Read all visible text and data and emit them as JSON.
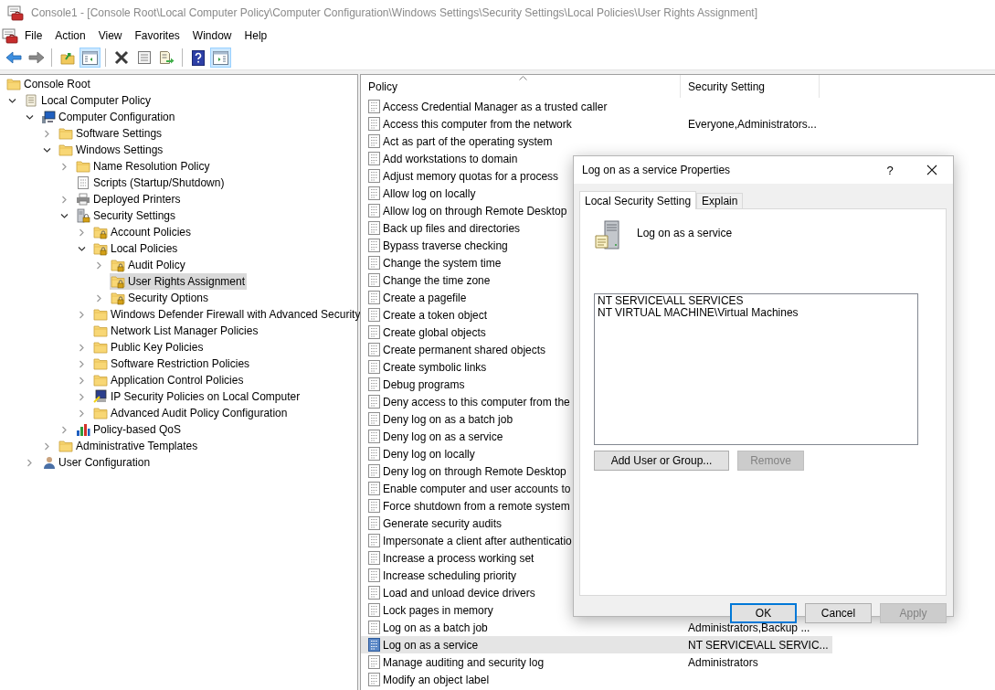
{
  "window": {
    "title": "Console1 - [Console Root\\Local Computer Policy\\Computer Configuration\\Windows Settings\\Security Settings\\Local Policies\\User Rights Assignment]"
  },
  "menu": [
    "File",
    "Action",
    "View",
    "Favorites",
    "Window",
    "Help"
  ],
  "toolbar": [
    {
      "kind": "back",
      "pressed": false
    },
    {
      "kind": "forward",
      "pressed": false
    },
    {
      "kind": "separator"
    },
    {
      "kind": "up",
      "pressed": false
    },
    {
      "kind": "tree-pane",
      "pressed": true
    },
    {
      "kind": "separator"
    },
    {
      "kind": "delete",
      "pressed": false
    },
    {
      "kind": "properties",
      "pressed": false
    },
    {
      "kind": "export",
      "pressed": false
    },
    {
      "kind": "separator"
    },
    {
      "kind": "help",
      "pressed": false
    },
    {
      "kind": "action-pane",
      "pressed": true
    }
  ],
  "tree": [
    {
      "label": "Console Root",
      "kind": "folder",
      "selected": false,
      "children": [
        {
          "label": "Local Computer Policy",
          "kind": "policy",
          "expanded": true,
          "selected": false,
          "children": [
            {
              "label": "Computer Configuration",
              "kind": "computer",
              "expanded": true,
              "selected": false,
              "children": [
                {
                  "label": "Software Settings",
                  "kind": "folder",
                  "expanded": false,
                  "selected": false
                },
                {
                  "label": "Windows Settings",
                  "kind": "folder",
                  "expanded": true,
                  "selected": false,
                  "children": [
                    {
                      "label": "Name Resolution Policy",
                      "kind": "folder",
                      "expanded": false,
                      "selected": false
                    },
                    {
                      "label": "Scripts (Startup/Shutdown)",
                      "kind": "scripts",
                      "selected": false
                    },
                    {
                      "label": "Deployed Printers",
                      "kind": "printer",
                      "expanded": false,
                      "selected": false
                    },
                    {
                      "label": "Security Settings",
                      "kind": "security",
                      "expanded": true,
                      "selected": false,
                      "children": [
                        {
                          "label": "Account Policies",
                          "kind": "locked-folder",
                          "expanded": false,
                          "selected": false
                        },
                        {
                          "label": "Local Policies",
                          "kind": "locked-folder",
                          "expanded": true,
                          "selected": false,
                          "children": [
                            {
                              "label": "Audit Policy",
                              "kind": "locked-folder",
                              "expanded": false,
                              "selected": false
                            },
                            {
                              "label": "User Rights Assignment",
                              "kind": "locked-folder",
                              "selected": true
                            },
                            {
                              "label": "Security Options",
                              "kind": "locked-folder",
                              "expanded": false,
                              "selected": false
                            }
                          ]
                        },
                        {
                          "label": "Windows Defender Firewall with Advanced Security",
                          "kind": "folder",
                          "expanded": false,
                          "selected": false
                        },
                        {
                          "label": "Network List Manager Policies",
                          "kind": "folder",
                          "selected": false
                        },
                        {
                          "label": "Public Key Policies",
                          "kind": "folder",
                          "expanded": false,
                          "selected": false
                        },
                        {
                          "label": "Software Restriction Policies",
                          "kind": "folder",
                          "expanded": false,
                          "selected": false
                        },
                        {
                          "label": "Application Control Policies",
                          "kind": "folder",
                          "expanded": false,
                          "selected": false
                        },
                        {
                          "label": "IP Security Policies on Local Computer",
                          "kind": "ip-security",
                          "expanded": false,
                          "selected": false
                        },
                        {
                          "label": "Advanced Audit Policy Configuration",
                          "kind": "folder",
                          "expanded": false,
                          "selected": false
                        }
                      ]
                    },
                    {
                      "label": "Policy-based QoS",
                      "kind": "qos",
                      "expanded": false,
                      "selected": false
                    }
                  ]
                },
                {
                  "label": "Administrative Templates",
                  "kind": "folder",
                  "expanded": false,
                  "selected": false
                }
              ]
            },
            {
              "label": "User Configuration",
              "kind": "user",
              "expanded": false,
              "selected": false
            }
          ]
        }
      ]
    }
  ],
  "table": {
    "columns": [
      "Policy",
      "Security Setting"
    ],
    "rows": [
      {
        "policy": "Access Credential Manager as a trusted caller",
        "selected": false
      },
      {
        "policy": "Access this computer from the network",
        "setting": "Everyone,Administrators...",
        "selected": false
      },
      {
        "policy": "Act as part of the operating system",
        "selected": false
      },
      {
        "policy": "Add workstations to domain",
        "selected": false
      },
      {
        "policy": "Adjust memory quotas for a process",
        "selected": false
      },
      {
        "policy": "Allow log on locally",
        "selected": false
      },
      {
        "policy": "Allow log on through Remote Desktop",
        "selected": false
      },
      {
        "policy": "Back up files and directories",
        "selected": false
      },
      {
        "policy": "Bypass traverse checking",
        "selected": false
      },
      {
        "policy": "Change the system time",
        "selected": false
      },
      {
        "policy": "Change the time zone",
        "selected": false
      },
      {
        "policy": "Create a pagefile",
        "selected": false
      },
      {
        "policy": "Create a token object",
        "selected": false
      },
      {
        "policy": "Create global objects",
        "selected": false
      },
      {
        "policy": "Create permanent shared objects",
        "selected": false
      },
      {
        "policy": "Create symbolic links",
        "selected": false
      },
      {
        "policy": "Debug programs",
        "selected": false
      },
      {
        "policy": "Deny access to this computer from the",
        "selected": false
      },
      {
        "policy": "Deny log on as a batch job",
        "selected": false
      },
      {
        "policy": "Deny log on as a service",
        "selected": false
      },
      {
        "policy": "Deny log on locally",
        "selected": false
      },
      {
        "policy": "Deny log on through Remote Desktop",
        "selected": false
      },
      {
        "policy": "Enable computer and user accounts to",
        "selected": false
      },
      {
        "policy": "Force shutdown from a remote system",
        "selected": false
      },
      {
        "policy": "Generate security audits",
        "selected": false
      },
      {
        "policy": "Impersonate a client after authenticatio",
        "selected": false
      },
      {
        "policy": "Increase a process working set",
        "selected": false
      },
      {
        "policy": "Increase scheduling priority",
        "selected": false
      },
      {
        "policy": "Load and unload device drivers",
        "selected": false
      },
      {
        "policy": "Lock pages in memory",
        "selected": false
      },
      {
        "policy": "Log on as a batch job",
        "setting": "Administrators,Backup ...",
        "selected": false
      },
      {
        "policy": "Log on as a service",
        "setting": "NT SERVICE\\ALL SERVIC...",
        "selected": true
      },
      {
        "policy": "Manage auditing and security log",
        "setting": "Administrators",
        "selected": false
      },
      {
        "policy": "Modify an object label",
        "selected": false
      }
    ]
  },
  "dialog": {
    "title": "Log on as a service Properties",
    "help": "?",
    "tabs": [
      {
        "label": "Local Security Setting",
        "selected": true
      },
      {
        "label": "Explain",
        "selected": false
      }
    ],
    "heading": "Log on as a service",
    "accounts": [
      "NT SERVICE\\ALL SERVICES",
      "NT VIRTUAL MACHINE\\Virtual Machines"
    ],
    "list_buttons": [
      {
        "label": "Add User or Group...",
        "disabled": false
      },
      {
        "label": "Remove",
        "disabled": true
      }
    ],
    "buttons": [
      {
        "label": "OK",
        "default": true,
        "disabled": false
      },
      {
        "label": "Cancel",
        "default": false,
        "disabled": false
      },
      {
        "label": "Apply",
        "default": false,
        "disabled": true
      }
    ]
  }
}
